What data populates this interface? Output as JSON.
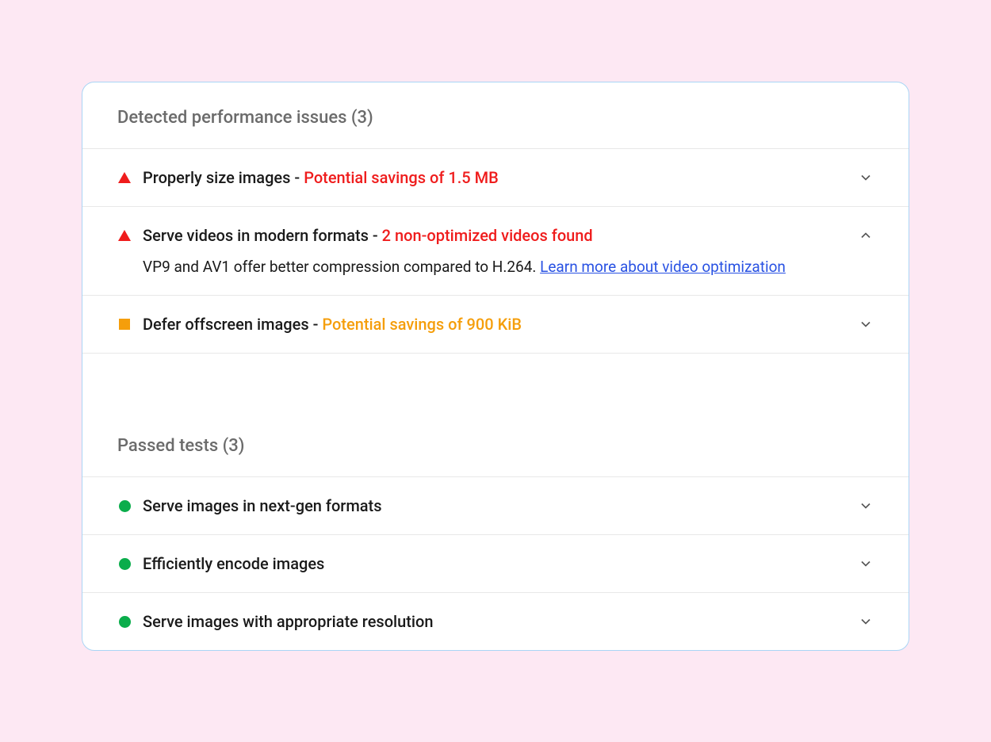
{
  "issues": {
    "title": "Detected performance issues (3)",
    "items": [
      {
        "title": "Properly size images",
        "detail": "Potential savings of 1.5 MB",
        "severity": "red",
        "expanded": false
      },
      {
        "title": "Serve videos in modern formats",
        "detail": "2 non-optimized videos found",
        "severity": "red",
        "expanded": true,
        "description": "VP9 and AV1 offer better compression compared to H.264.",
        "link": "Learn more about video optimization"
      },
      {
        "title": "Defer offscreen images",
        "detail": "Potential savings of 900 KiB",
        "severity": "orange",
        "expanded": false
      }
    ]
  },
  "passed": {
    "title": "Passed tests (3)",
    "items": [
      {
        "title": "Serve images in next-gen formats"
      },
      {
        "title": "Efficiently encode images"
      },
      {
        "title": "Serve images with appropriate resolution"
      }
    ]
  }
}
